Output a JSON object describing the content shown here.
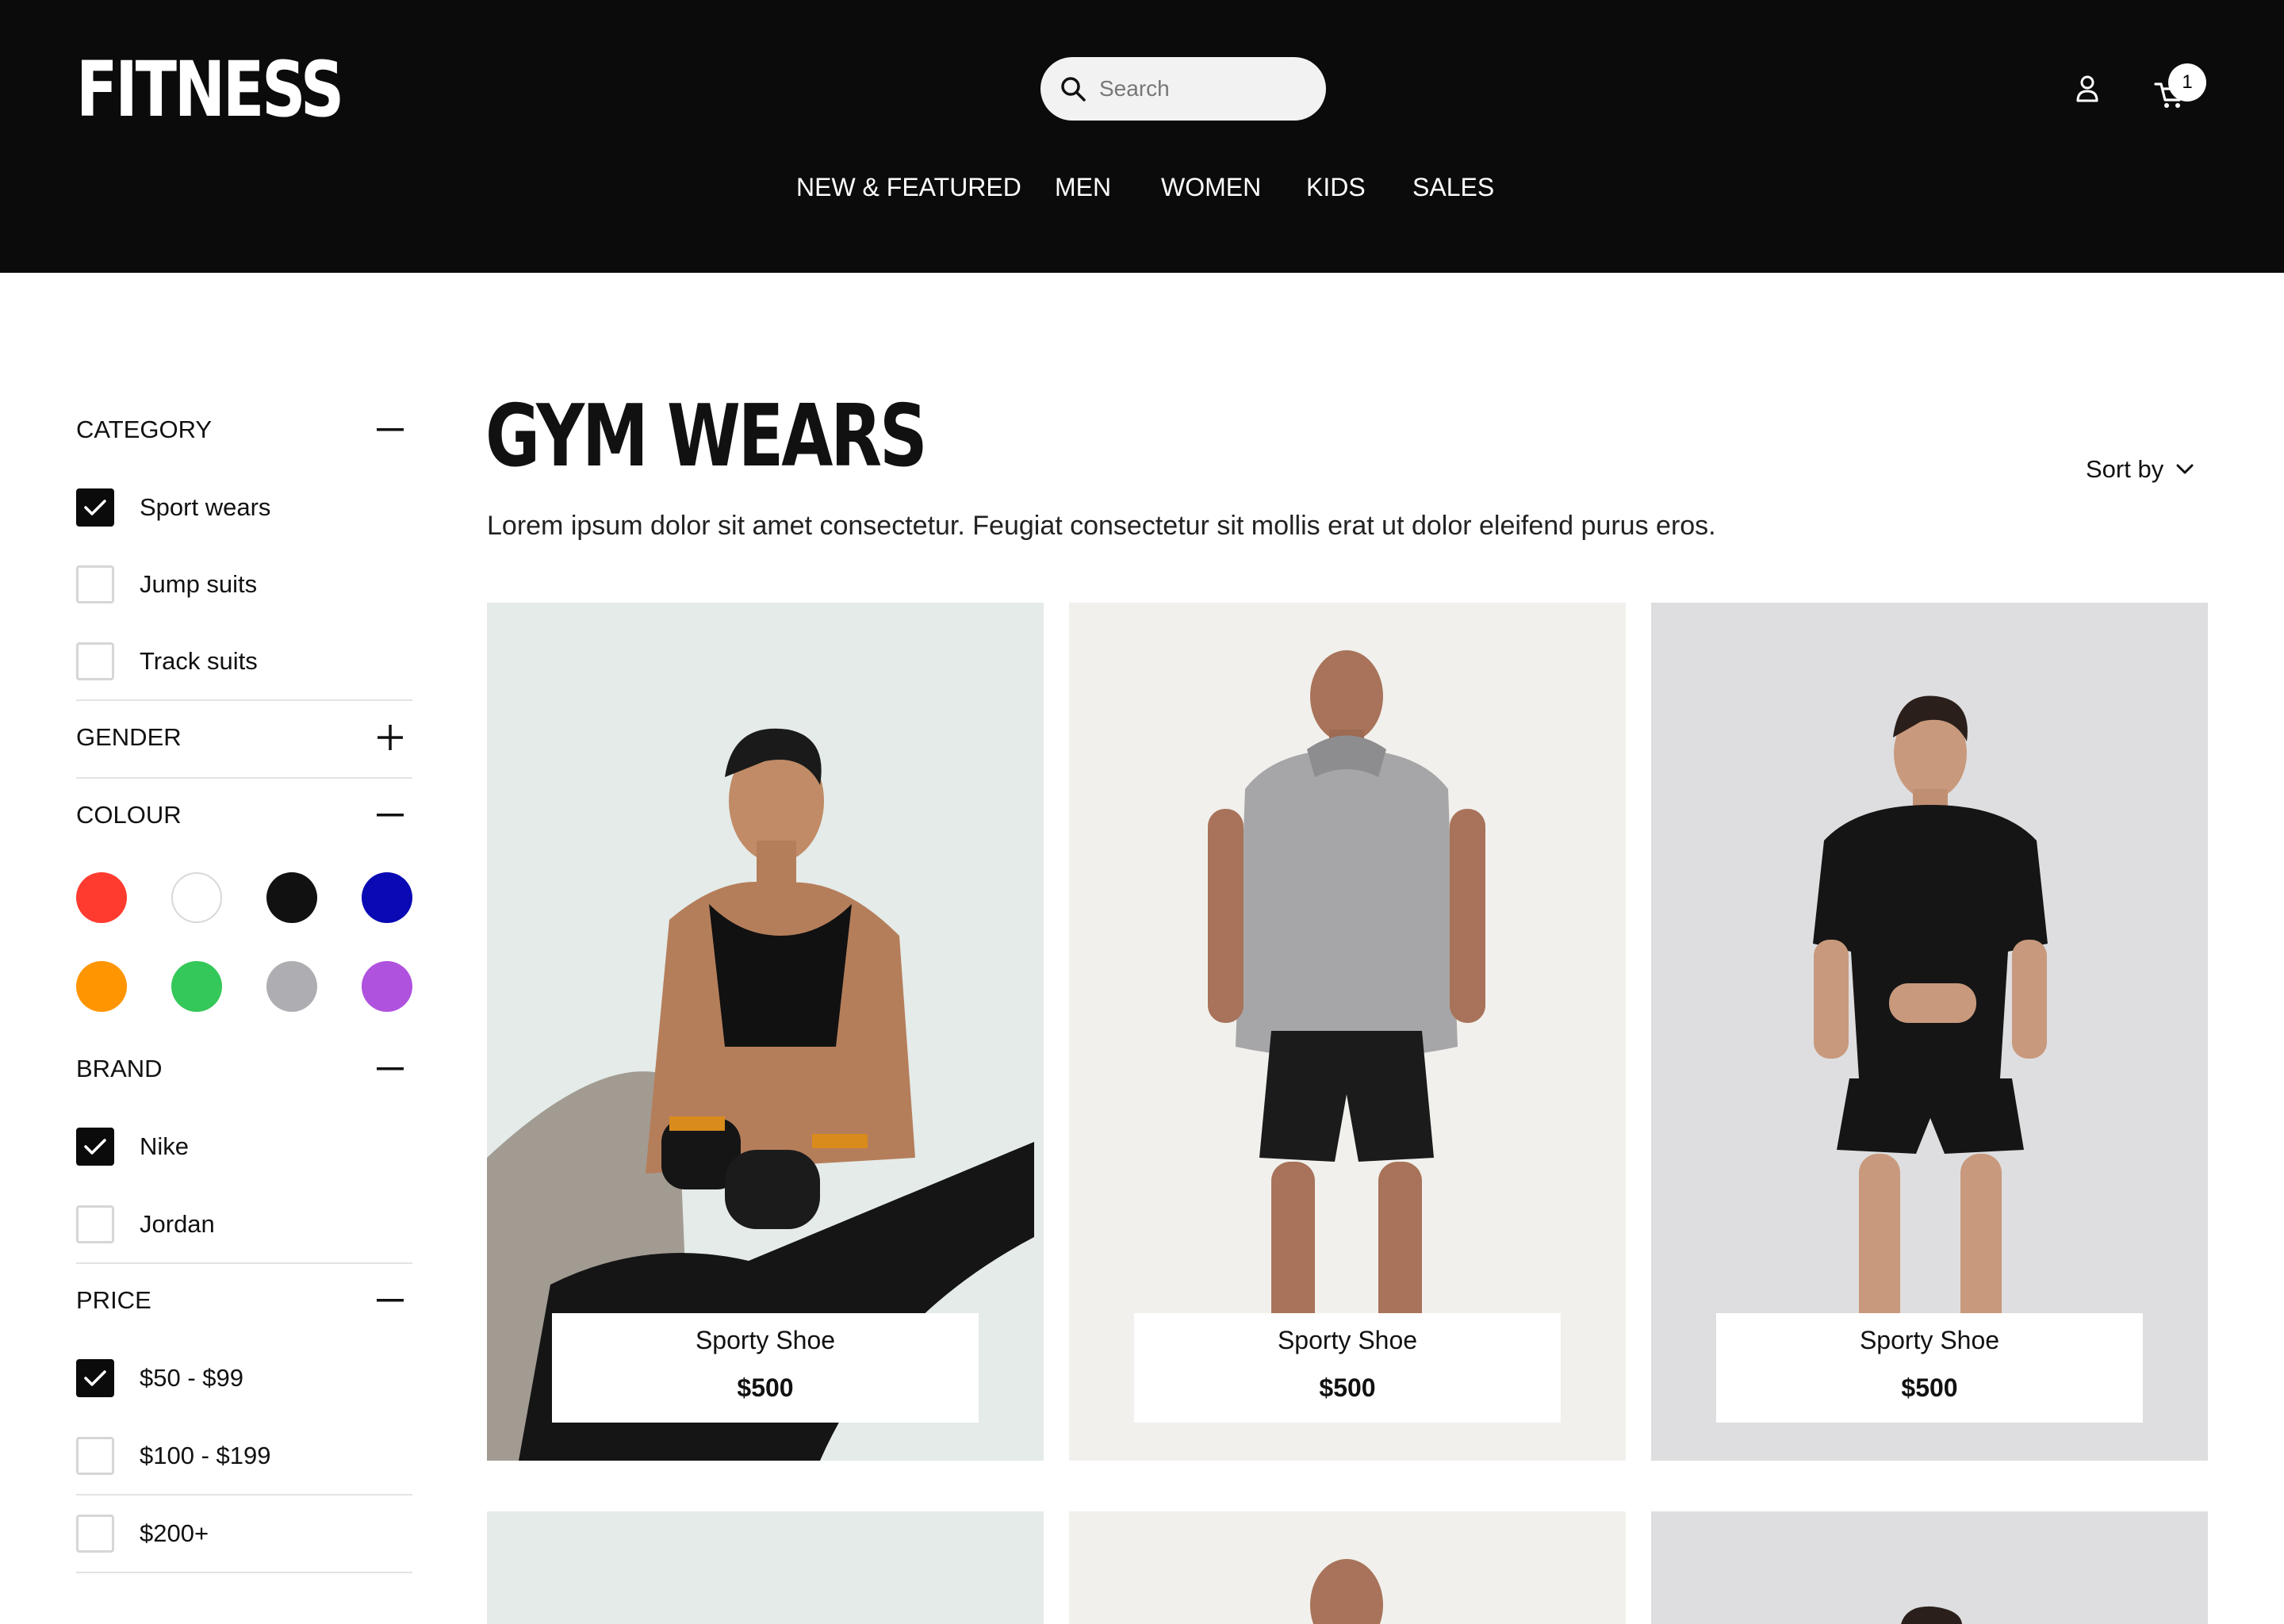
{
  "header": {
    "logo": "FITNESS",
    "search_placeholder": "Search",
    "cart_count": "1",
    "nav": [
      {
        "label": "NEW & FEATURED"
      },
      {
        "label": "MEN"
      },
      {
        "label": "WOMEN"
      },
      {
        "label": "KIDS"
      },
      {
        "label": "SALES"
      }
    ]
  },
  "sidebar": {
    "category": {
      "title": "CATEGORY",
      "expanded": true,
      "options": [
        {
          "label": "Sport wears",
          "checked": true
        },
        {
          "label": "Jump suits",
          "checked": false
        },
        {
          "label": "Track suits",
          "checked": false
        }
      ]
    },
    "gender": {
      "title": "GENDER",
      "expanded": false
    },
    "colour": {
      "title": "COLOUR",
      "expanded": true,
      "swatches": [
        {
          "name": "red",
          "color": "#ff3b30"
        },
        {
          "name": "white",
          "color": "#ffffff"
        },
        {
          "name": "black",
          "color": "#111111"
        },
        {
          "name": "blue",
          "color": "#0a0ab4"
        },
        {
          "name": "orange",
          "color": "#ff9500"
        },
        {
          "name": "green",
          "color": "#34c759"
        },
        {
          "name": "gray",
          "color": "#aeaeb2"
        },
        {
          "name": "purple",
          "color": "#af52de"
        }
      ]
    },
    "brand": {
      "title": "BRAND",
      "expanded": true,
      "options": [
        {
          "label": "Nike",
          "checked": true
        },
        {
          "label": "Jordan",
          "checked": false
        }
      ]
    },
    "price": {
      "title": "PRICE",
      "expanded": true,
      "options": [
        {
          "label": "$50 - $99",
          "checked": true
        },
        {
          "label": "$100 - $199",
          "checked": false
        },
        {
          "label": "$200+",
          "checked": false
        }
      ]
    }
  },
  "main": {
    "title": "GYM WEARS",
    "description": "Lorem ipsum dolor sit amet consectetur. Feugiat consectetur sit mollis erat ut dolor eleifend purus eros.",
    "sort_label": "Sort by",
    "products": [
      {
        "name": "Sporty Shoe",
        "price": "$500"
      },
      {
        "name": "Sporty Shoe",
        "price": "$500"
      },
      {
        "name": "Sporty Shoe",
        "price": "$500"
      }
    ]
  },
  "colors": {
    "header_bg": "#0b0b0b",
    "text": "#111111",
    "divider": "#e3e3e3",
    "card_bg_1": "#e6ecea",
    "card_bg_2": "#f2f1ee",
    "card_bg_3": "#dfdfe1"
  }
}
